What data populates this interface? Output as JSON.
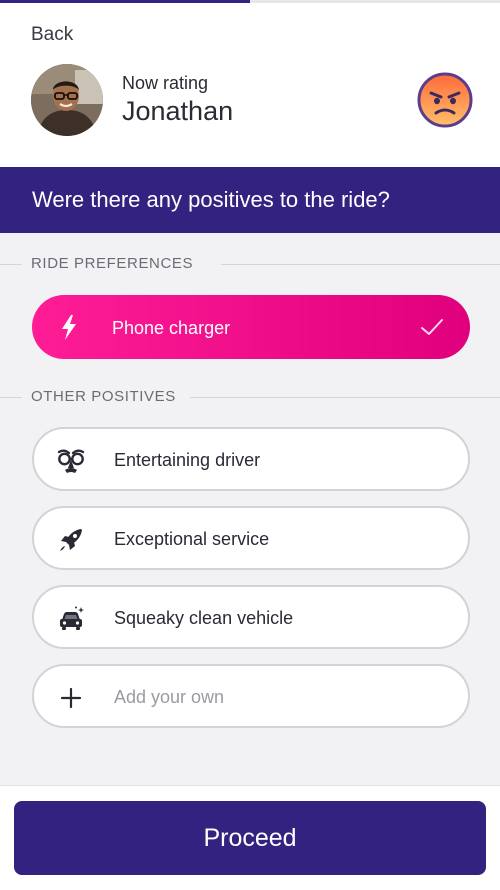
{
  "progress": {
    "fraction": 0.5,
    "color": "#33227f"
  },
  "nav": {
    "back_label": "Back"
  },
  "driver": {
    "rating_label": "Now rating",
    "name": "Jonathan",
    "mood_icon": "angry-face-icon"
  },
  "question": "Were there any positives to the ride?",
  "sections": {
    "ride_preferences": {
      "title": "RIDE PREFERENCES",
      "items": [
        {
          "label": "Phone charger",
          "icon": "lightning-bolt-icon",
          "selected": true
        }
      ]
    },
    "other_positives": {
      "title": "OTHER POSITIVES",
      "items": [
        {
          "label": "Entertaining driver",
          "icon": "funny-glasses-icon",
          "selected": false
        },
        {
          "label": "Exceptional service",
          "icon": "rocket-icon",
          "selected": false
        },
        {
          "label": "Squeaky clean vehicle",
          "icon": "clean-car-icon",
          "selected": false
        }
      ],
      "add_own_placeholder": "Add your own",
      "add_icon": "plus-icon"
    }
  },
  "footer": {
    "proceed_label": "Proceed"
  },
  "colors": {
    "brand": "#33227f",
    "accent": "#ff1d96",
    "background": "#f2f2f5"
  }
}
